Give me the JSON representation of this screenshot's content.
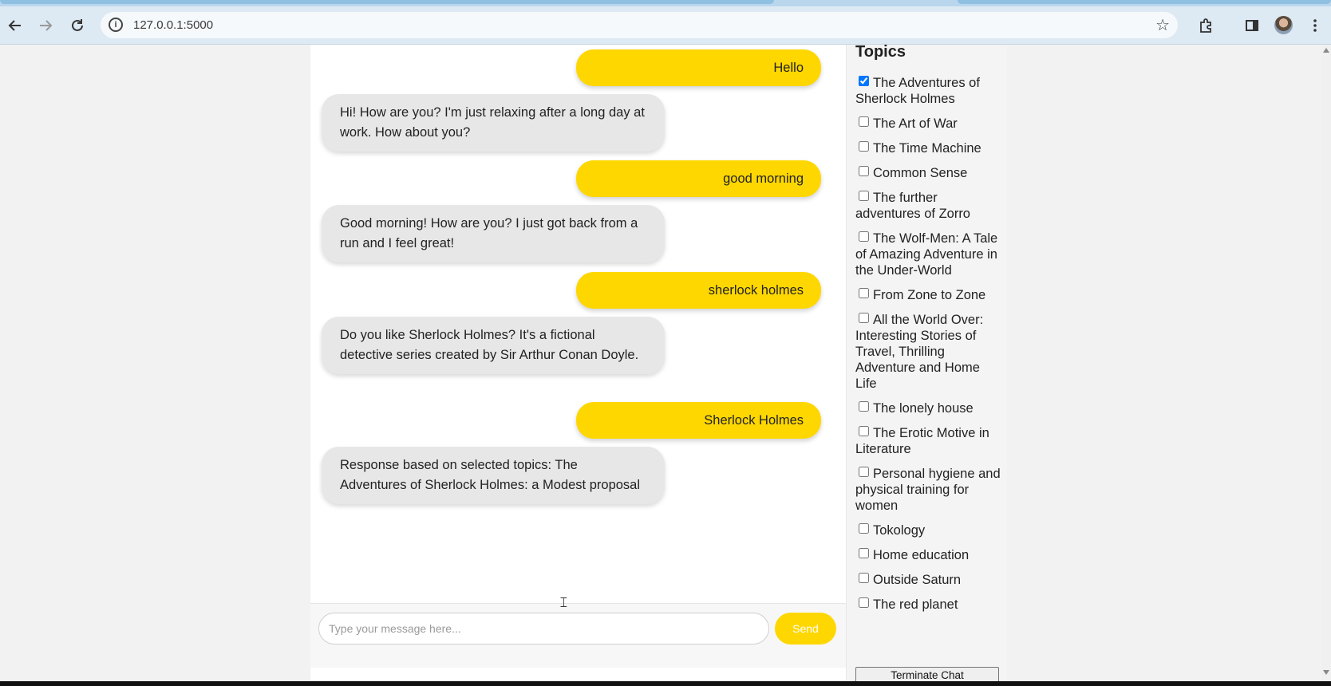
{
  "browser": {
    "url": "127.0.0.1:5000",
    "icons": [
      "back-arrow-icon",
      "forward-arrow-icon",
      "reload-icon",
      "site-info-icon",
      "bookmark-star-icon",
      "extensions-icon",
      "side-panel-icon",
      "profile-avatar",
      "more-menu-icon"
    ]
  },
  "chat": {
    "messages": [
      {
        "role": "user",
        "text": "Hello"
      },
      {
        "role": "bot",
        "text": "Hi! How are you? I'm just relaxing after a long day at work. How about you?"
      },
      {
        "role": "user",
        "text": "good morning"
      },
      {
        "role": "bot",
        "text": "Good morning! How are you? I just got back from a run and I feel great!"
      },
      {
        "role": "user",
        "text": "sherlock holmes"
      },
      {
        "role": "bot",
        "text": "Do you like Sherlock Holmes? It's a fictional detective series created by Sir Arthur Conan Doyle."
      },
      {
        "role": "user",
        "text": "Sherlock Holmes"
      },
      {
        "role": "bot",
        "text": "Response based on selected topics: The Adventures of Sherlock Holmes: a Modest proposal"
      }
    ],
    "input": {
      "placeholder": "Type your message here...",
      "value": ""
    },
    "send_label": "Send"
  },
  "topics": {
    "title": "Topics",
    "items": [
      {
        "label": "The Adventures of Sherlock Holmes",
        "checked": true
      },
      {
        "label": "The Art of War",
        "checked": false
      },
      {
        "label": "The Time Machine",
        "checked": false
      },
      {
        "label": "Common Sense",
        "checked": false
      },
      {
        "label": "The further adventures of Zorro",
        "checked": false
      },
      {
        "label": "The Wolf-Men: A Tale of Amazing Adventure in the Under-World",
        "checked": false
      },
      {
        "label": "From Zone to Zone",
        "checked": false
      },
      {
        "label": "All the World Over: Interesting Stories of Travel, Thrilling Adventure and Home Life",
        "checked": false
      },
      {
        "label": "The lonely house",
        "checked": false
      },
      {
        "label": "The Erotic Motive in Literature",
        "checked": false
      },
      {
        "label": "Personal hygiene and physical training for women",
        "checked": false
      },
      {
        "label": "Tokology",
        "checked": false
      },
      {
        "label": "Home education",
        "checked": false
      },
      {
        "label": "Outside Saturn",
        "checked": false
      },
      {
        "label": "The red planet",
        "checked": false
      }
    ],
    "terminate_label": "Terminate Chat"
  },
  "colors": {
    "user_bubble": "#fed700",
    "bot_bubble": "#e7e7e7",
    "send_button": "#fed700"
  }
}
